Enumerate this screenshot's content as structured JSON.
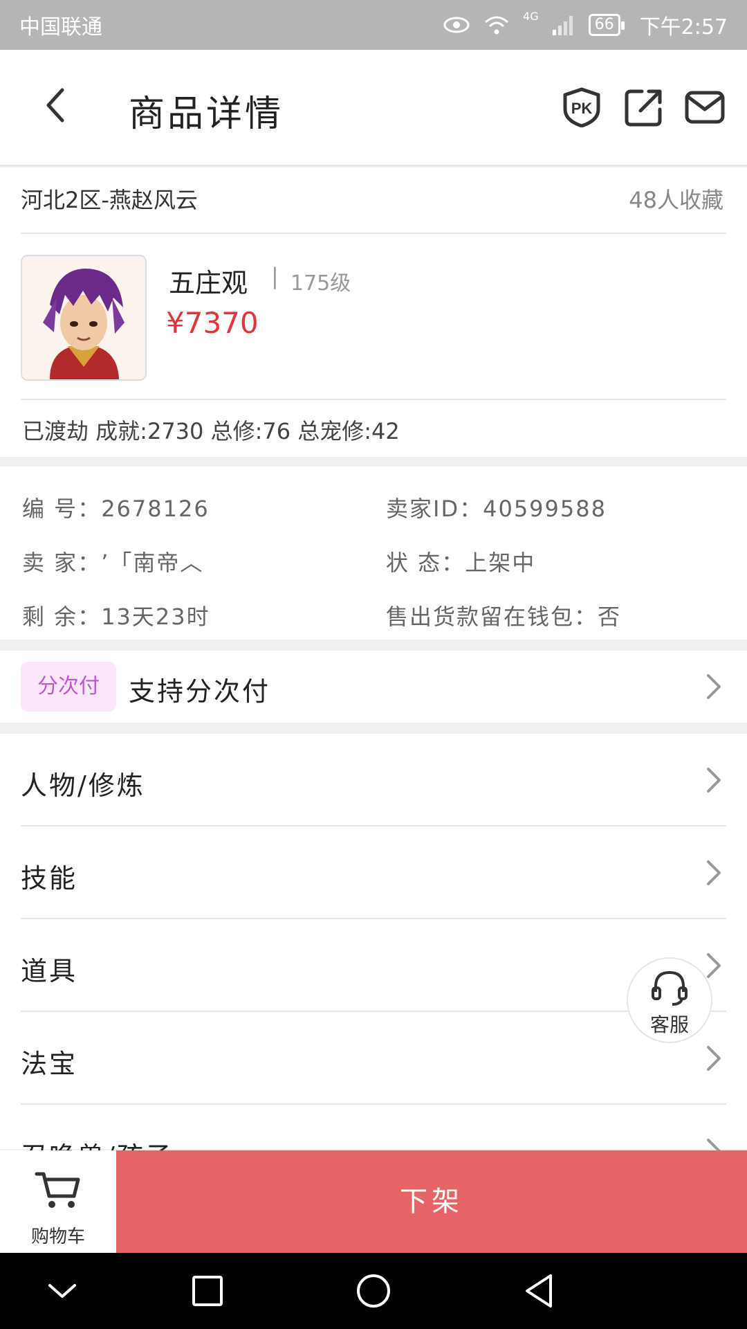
{
  "status_bar": {
    "carrier": "中国联通",
    "network": "4G",
    "battery": "66",
    "time": "下午2:57"
  },
  "header": {
    "title": "商品详情"
  },
  "listing": {
    "server": "河北2区-燕赵风云",
    "favorites": "48人收藏",
    "character_name": "五庄观",
    "separator": "|",
    "level": "175级",
    "price": "¥7370",
    "achievements": "已渡劫 成就:2730 总修:76 总宠修:42"
  },
  "info": {
    "id_label": "编  号：",
    "id_value": "2678126",
    "seller_id_label": "卖家ID：",
    "seller_id_value": "40599588",
    "seller_label": "卖  家：",
    "seller_value": "ʼ「南帝︿",
    "status_label": "状  态：",
    "status_value": "上架中",
    "remaining_label": "剩  余：",
    "remaining_value": "13天23时",
    "wallet_label": "售出货款留在钱包：",
    "wallet_value": "否"
  },
  "installment": {
    "badge": "分次付",
    "text": "支持分次付"
  },
  "menu": [
    {
      "label": "人物/修炼"
    },
    {
      "label": "技能"
    },
    {
      "label": "道具"
    },
    {
      "label": "法宝"
    },
    {
      "label": "召唤兽/孩子"
    }
  ],
  "service": {
    "label": "客服"
  },
  "bottom": {
    "cart_label": "购物车",
    "delist_label": "下架"
  },
  "colors": {
    "price": "#e0363a",
    "delist": "#e56566",
    "badge_bg": "#fbe7fb",
    "badge_text": "#c158d3"
  }
}
